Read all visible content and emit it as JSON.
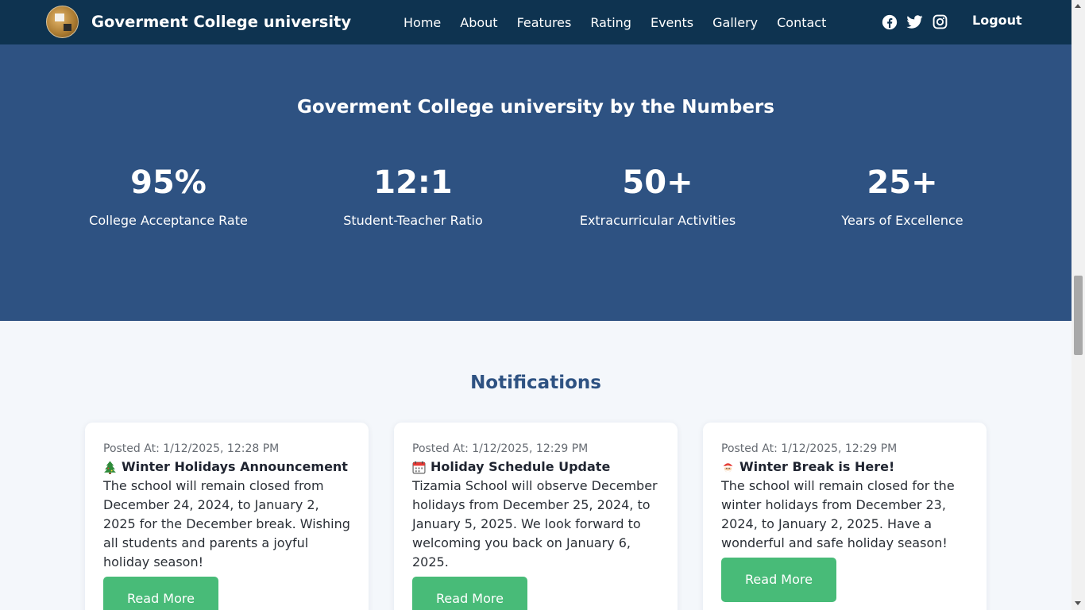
{
  "nav": {
    "brand_title": "Goverment College university",
    "links": [
      "Home",
      "About",
      "Features",
      "Rating",
      "Events",
      "Gallery",
      "Contact"
    ],
    "social_icons": [
      "facebook-icon",
      "twitter-icon",
      "instagram-icon"
    ],
    "logout_label": "Logout"
  },
  "stats": {
    "title": "Goverment College university by the Numbers",
    "items": [
      {
        "value": "95%",
        "label": "College Acceptance Rate"
      },
      {
        "value": "12:1",
        "label": "Student-Teacher Ratio"
      },
      {
        "value": "50+",
        "label": "Extracurricular Activities"
      },
      {
        "value": "25+",
        "label": "Years of Excellence"
      }
    ]
  },
  "notifications": {
    "title": "Notifications",
    "cards": [
      {
        "posted": "Posted At: 1/12/2025, 12:28 PM",
        "icon": "christmas-tree-icon",
        "heading": "Winter Holidays Announcement",
        "text": "The school will remain closed from December 24, 2024, to January 2, 2025 for the December break. Wishing all students and parents a joyful holiday season!",
        "button": "Read More"
      },
      {
        "posted": "Posted At: 1/12/2025, 12:29 PM",
        "icon": "calendar-icon",
        "heading": "Holiday Schedule Update",
        "text": "Tizamia School will observe December holidays from December 25, 2024, to January 5, 2025. We look forward to welcoming you back on January 6, 2025.",
        "button": "Read More"
      },
      {
        "posted": "Posted At: 1/12/2025, 12:29 PM",
        "icon": "santa-icon",
        "heading": "Winter Break is Here!",
        "text": "The school will remain closed for the winter holidays from December 23, 2024, to January 2, 2025. Have a wonderful and safe holiday season!",
        "button": "Read More"
      }
    ]
  },
  "colors": {
    "navbar": "#0e3350",
    "stats_background": "#2e5282",
    "accent_green": "#48bb78",
    "page_background": "#f4f7fb"
  }
}
